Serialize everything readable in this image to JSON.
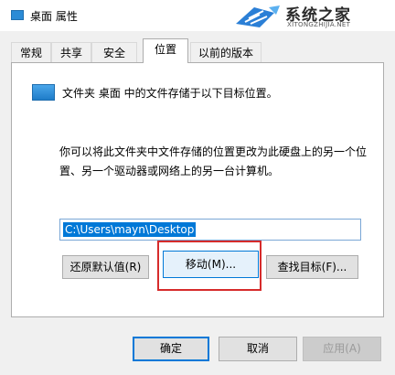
{
  "window": {
    "title": "桌面 属性"
  },
  "watermark": {
    "name": "系统之家",
    "url": "XITONGZHIJIA.NET"
  },
  "tabs": [
    "常规",
    "共享",
    "安全",
    "位置",
    "以前的版本"
  ],
  "active_tab": "位置",
  "location": {
    "description": "文件夹 桌面 中的文件存储于以下目标位置。",
    "paragraph": "你可以将此文件夹中文件存储的位置更改为此硬盘上的另一个位置、另一个驱动器或网络上的另一台计算机。",
    "path": "C:\\Users\\mayn\\Desktop",
    "restore_label": "还原默认值(R)",
    "move_label": "移动(M)...",
    "find_label": "查找目标(F)..."
  },
  "footer": {
    "ok_label": "确定",
    "cancel_label": "取消",
    "apply_label": "应用(A)"
  },
  "colors": {
    "accent": "#0078d7",
    "highlight": "#d62b2b",
    "folder": "#2b8bd6"
  }
}
